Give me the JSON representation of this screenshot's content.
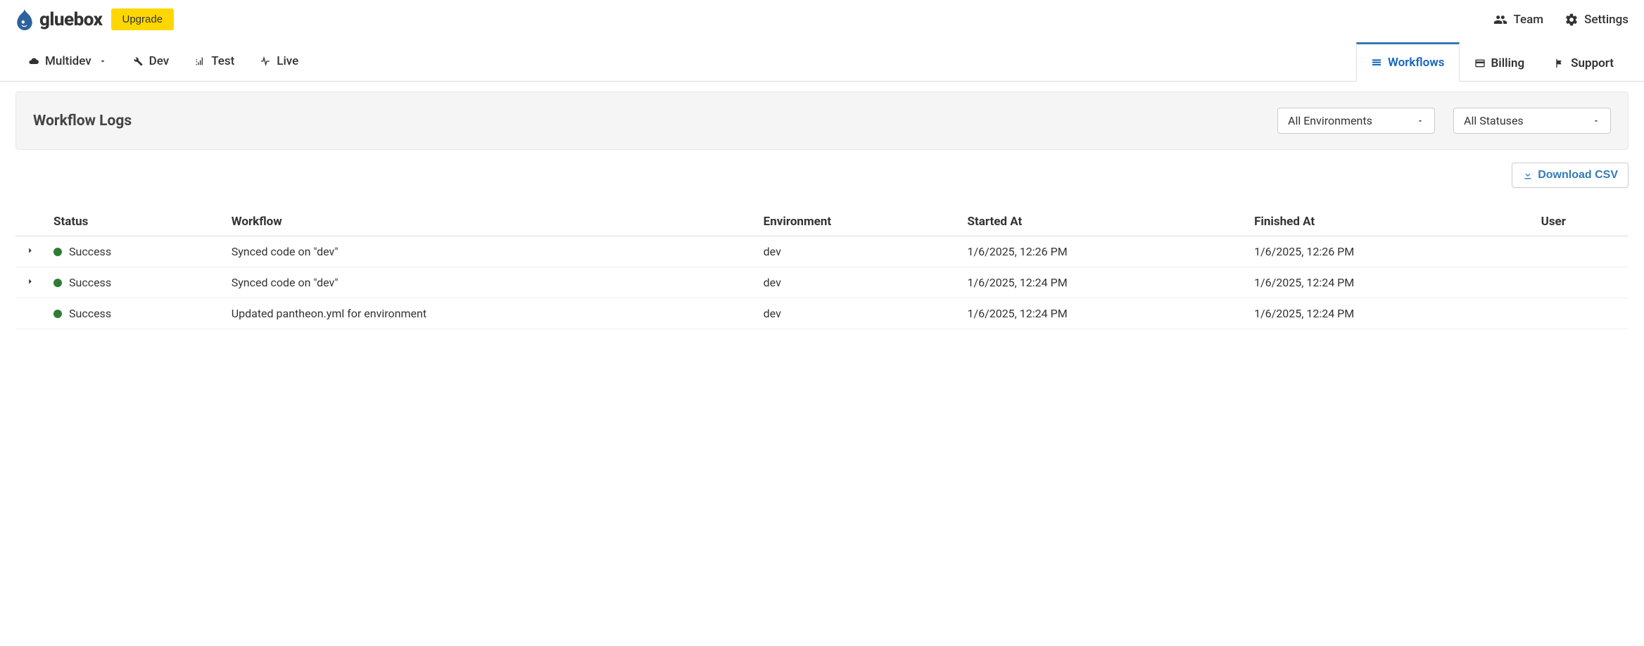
{
  "header": {
    "site_name": "gluebox",
    "upgrade_label": "Upgrade",
    "team_label": "Team",
    "settings_label": "Settings"
  },
  "env_tabs": {
    "multidev": "Multidev",
    "dev": "Dev",
    "test": "Test",
    "live": "Live"
  },
  "main_tabs": {
    "workflows": "Workflows",
    "billing": "Billing",
    "support": "Support"
  },
  "panel": {
    "title": "Workflow Logs",
    "env_filter": "All Environments",
    "status_filter": "All Statuses"
  },
  "actions": {
    "download_csv": "Download CSV"
  },
  "table": {
    "headers": {
      "status": "Status",
      "workflow": "Workflow",
      "environment": "Environment",
      "started": "Started At",
      "finished": "Finished At",
      "user": "User"
    },
    "rows": [
      {
        "expandable": true,
        "status": "Success",
        "status_color": "#2e7d32",
        "workflow": "Synced code on \"dev\"",
        "environment": "dev",
        "started": "1/6/2025, 12:26 PM",
        "finished": "1/6/2025, 12:26 PM",
        "user": ""
      },
      {
        "expandable": true,
        "status": "Success",
        "status_color": "#2e7d32",
        "workflow": "Synced code on \"dev\"",
        "environment": "dev",
        "started": "1/6/2025, 12:24 PM",
        "finished": "1/6/2025, 12:24 PM",
        "user": ""
      },
      {
        "expandable": false,
        "status": "Success",
        "status_color": "#2e7d32",
        "workflow": "Updated pantheon.yml for environment",
        "environment": "dev",
        "started": "1/6/2025, 12:24 PM",
        "finished": "1/6/2025, 12:24 PM",
        "user": ""
      }
    ]
  }
}
